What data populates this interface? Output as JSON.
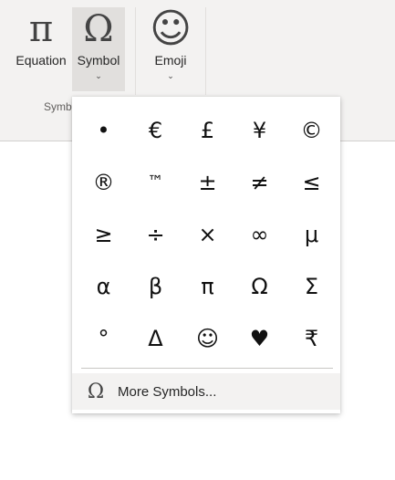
{
  "ribbon": {
    "equation": {
      "label": "Equation",
      "icon": "π"
    },
    "symbol": {
      "label": "Symbol",
      "icon": "Ω",
      "chevron": "⌄"
    },
    "emoji": {
      "label": "Emoji",
      "icon": "☺",
      "chevron": "⌄"
    },
    "group_label": "Symb"
  },
  "dropdown": {
    "symbols": [
      "•",
      "€",
      "£",
      "¥",
      "©",
      "®",
      "™",
      "±",
      "≠",
      "≤",
      "≥",
      "÷",
      "×",
      "∞",
      "μ",
      "α",
      "β",
      "π",
      "Ω",
      "Σ",
      "°",
      "Δ",
      "☺",
      "♥",
      "₹"
    ],
    "more": {
      "icon": "Ω",
      "label": "More Symbols..."
    }
  }
}
